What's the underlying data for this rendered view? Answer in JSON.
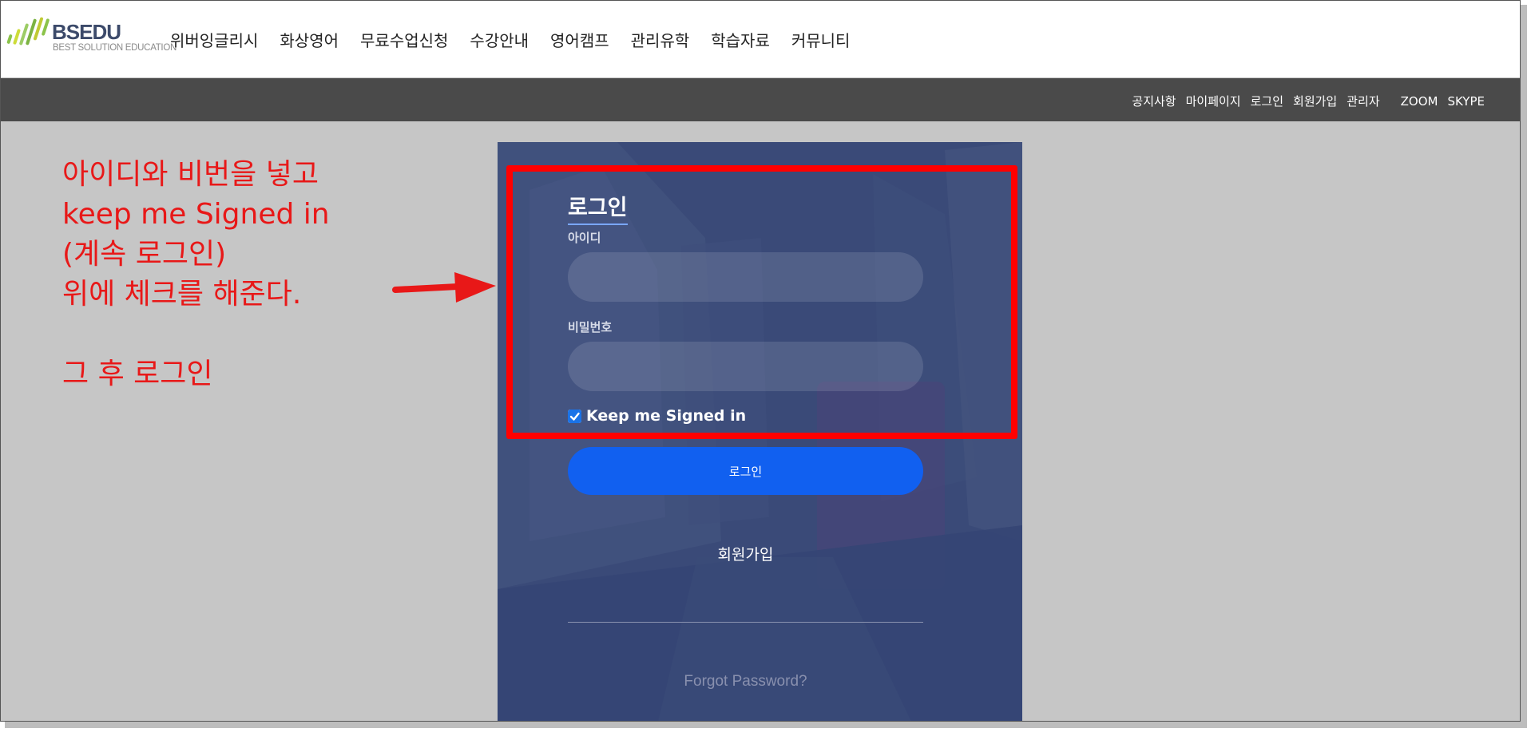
{
  "brand": {
    "logo_text": "BSEDU",
    "logo_subtitle": "BEST SOLUTION EDUCATION",
    "bar_colors": [
      "#8bc34a",
      "#cddc39",
      "#9ccc65",
      "#7cb342",
      "#c0ca33"
    ]
  },
  "nav": {
    "items": [
      {
        "label": "위버잉글리시"
      },
      {
        "label": "화상영어"
      },
      {
        "label": "무료수업신청"
      },
      {
        "label": "수강안내"
      },
      {
        "label": "영어캠프"
      },
      {
        "label": "관리유학"
      },
      {
        "label": "학습자료"
      },
      {
        "label": "커뮤니티"
      }
    ]
  },
  "subbar": {
    "links": [
      {
        "label": "공지사항"
      },
      {
        "label": "마이페이지"
      },
      {
        "label": "로그인"
      },
      {
        "label": "회원가입"
      },
      {
        "label": "관리자"
      },
      {
        "label": "ZOOM"
      },
      {
        "label": "SKYPE"
      }
    ]
  },
  "annotation": {
    "lines": [
      "아이디와 비번을 넣고",
      "keep me Signed in",
      "(계속 로그인)",
      "위에 체크를 해준다.",
      "",
      "그 후 로그인"
    ],
    "color": "#e81818"
  },
  "login": {
    "title": "로그인",
    "id_label": "아이디",
    "id_value": "",
    "password_label": "비밀번호",
    "password_value": "",
    "keep_signed_in_label": "Keep me Signed in",
    "keep_signed_in_checked": true,
    "submit_label": "로그인",
    "signup_label": "회원가입",
    "forgot_label": "Forgot Password?",
    "button_color": "#1160f0"
  }
}
